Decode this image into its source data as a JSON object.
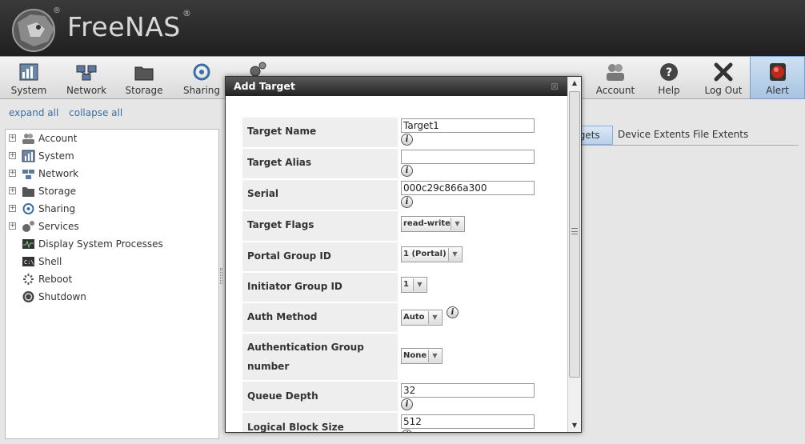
{
  "app": {
    "logo_text": "FreeNAS",
    "reg_mark": "®"
  },
  "toolbar": {
    "items": [
      {
        "label": "System",
        "icon": "system-icon"
      },
      {
        "label": "Network",
        "icon": "network-icon"
      },
      {
        "label": "Storage",
        "icon": "storage-icon"
      },
      {
        "label": "Sharing",
        "icon": "sharing-icon"
      },
      {
        "label": "Services",
        "icon": "services-icon"
      },
      {
        "label": "Account",
        "icon": "account-icon"
      },
      {
        "label": "Help",
        "icon": "help-icon"
      },
      {
        "label": "Log Out",
        "icon": "logout-icon"
      },
      {
        "label": "Alert",
        "icon": "alert-icon"
      }
    ]
  },
  "tree_controls": {
    "expand": "expand all",
    "collapse": "collapse all"
  },
  "tree": {
    "items": [
      {
        "label": "Account",
        "expandable": true
      },
      {
        "label": "System",
        "expandable": true
      },
      {
        "label": "Network",
        "expandable": true
      },
      {
        "label": "Storage",
        "expandable": true
      },
      {
        "label": "Sharing",
        "expandable": true
      },
      {
        "label": "Services",
        "expandable": true
      },
      {
        "label": "Display System Processes",
        "expandable": false
      },
      {
        "label": "Shell",
        "expandable": false
      },
      {
        "label": "Reboot",
        "expandable": false
      },
      {
        "label": "Shutdown",
        "expandable": false
      }
    ]
  },
  "right_tabs": {
    "targets": "rgets",
    "device_extents": "Device Extents",
    "file_extents": "File Extents"
  },
  "dialog": {
    "title": "Add Target",
    "close": "⊠",
    "fields": {
      "target_name": {
        "label": "Target Name",
        "value": "Target1"
      },
      "target_alias": {
        "label": "Target Alias",
        "value": ""
      },
      "serial": {
        "label": "Serial",
        "value": "000c29c866a300"
      },
      "target_flags": {
        "label": "Target Flags",
        "value": "read-write"
      },
      "portal_group": {
        "label": "Portal Group ID",
        "value": "1 (Portal)"
      },
      "initiator_group": {
        "label": "Initiator Group ID",
        "value": "1"
      },
      "auth_method": {
        "label": "Auth Method",
        "value": "Auto"
      },
      "auth_group": {
        "label_line1": "Authentication Group",
        "label_line2": "number",
        "value": "None"
      },
      "queue_depth": {
        "label": "Queue Depth",
        "value": "32"
      },
      "block_size": {
        "label": "Logical Block Size",
        "value": "512"
      }
    },
    "info_glyph": "i"
  },
  "colors": {
    "header_bg": "#2b2b2b",
    "link": "#3a6fa5",
    "label_bg": "#eeeeee",
    "alert_bg": "#b9d1ea"
  }
}
